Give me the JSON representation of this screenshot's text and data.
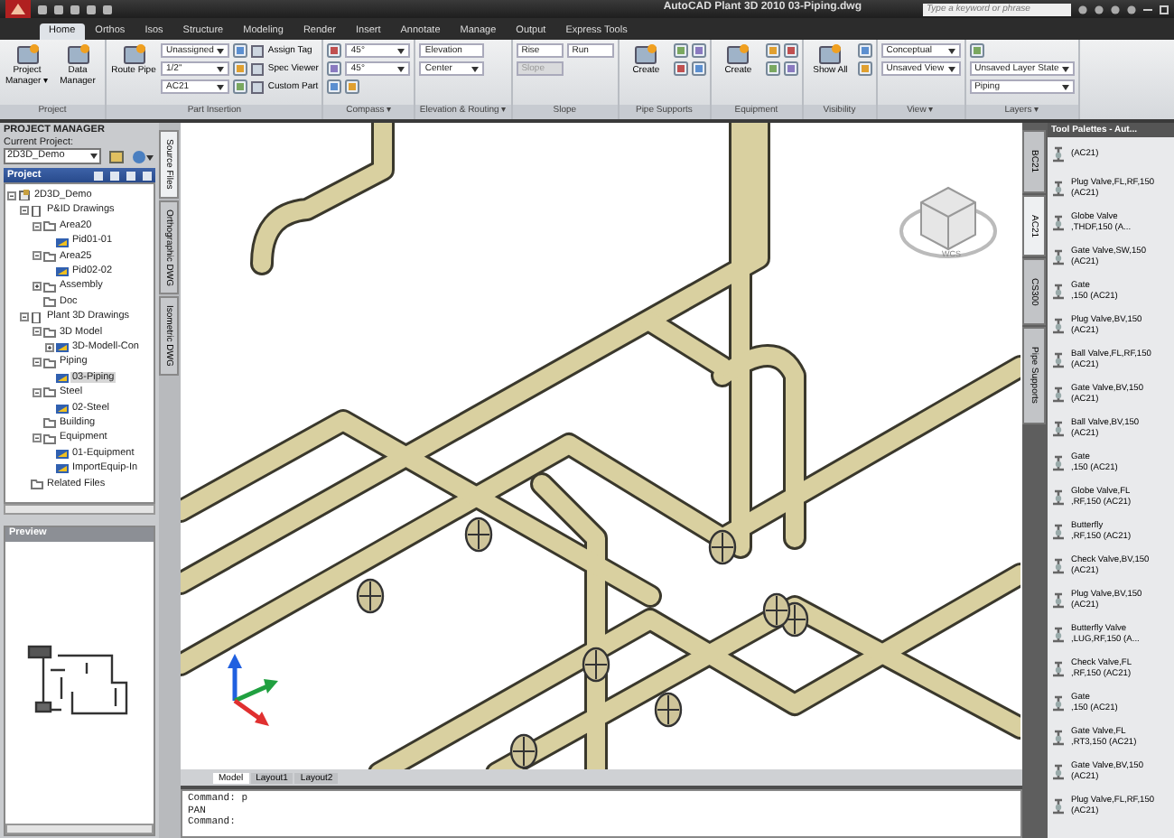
{
  "title_bar": {
    "title": "AutoCAD Plant 3D 2010",
    "file": "03-Piping.dwg",
    "search": {
      "placeholder": "Type a keyword or phrase"
    }
  },
  "ribbon_tabs": [
    {
      "label": "Home",
      "selected": true
    },
    {
      "label": "Orthos",
      "selected": false
    },
    {
      "label": "Isos",
      "selected": false
    },
    {
      "label": "Structure",
      "selected": false
    },
    {
      "label": "Modeling",
      "selected": false
    },
    {
      "label": "Render",
      "selected": false
    },
    {
      "label": "Insert",
      "selected": false
    },
    {
      "label": "Annotate",
      "selected": false
    },
    {
      "label": "Manage",
      "selected": false
    },
    {
      "label": "Output",
      "selected": false
    },
    {
      "label": "Express Tools",
      "selected": false
    }
  ],
  "ribbon_panels": [
    {
      "title": "Project",
      "columns": [
        [
          {
            "kind": "large",
            "label": "Project Manager ▾"
          }
        ],
        [
          {
            "kind": "large",
            "label": "Data Manager"
          }
        ]
      ]
    },
    {
      "title": "Part Insertion",
      "columns": [
        [
          {
            "kind": "large",
            "label": "Route Pipe"
          }
        ],
        [
          {
            "kind": "combo",
            "value": "Unassigned"
          },
          {
            "kind": "combo",
            "value": "1/2\""
          },
          {
            "kind": "combo",
            "value": "AC21"
          }
        ],
        [
          {
            "kind": "icon"
          },
          {
            "kind": "icon"
          },
          {
            "kind": "icon"
          }
        ],
        [
          {
            "kind": "small",
            "label": "Assign Tag"
          },
          {
            "kind": "small",
            "label": "Spec Viewer"
          },
          {
            "kind": "small",
            "label": "Custom Part"
          }
        ]
      ]
    },
    {
      "title": "Compass ▾",
      "columns": [
        [
          {
            "kind": "icon"
          },
          {
            "kind": "icon"
          },
          {
            "kind": "icon"
          }
        ],
        [
          {
            "kind": "combo",
            "value": "45°"
          },
          {
            "kind": "combo",
            "value": "45°"
          },
          {
            "kind": "icon"
          }
        ]
      ]
    },
    {
      "title": "Elevation & Routing ▾",
      "columns": [
        [
          {
            "kind": "field",
            "value": "Elevation",
            "disabled": false
          },
          {
            "kind": "combo",
            "value": "Center"
          }
        ]
      ]
    },
    {
      "title": "Slope",
      "columns": [
        [
          {
            "kind": "field",
            "value": "Rise",
            "disabled": false
          },
          {
            "kind": "field",
            "value": "Slope",
            "disabled": true
          }
        ],
        [
          {
            "kind": "field",
            "value": "Run",
            "disabled": false
          }
        ]
      ]
    },
    {
      "title": "Pipe Supports",
      "columns": [
        [
          {
            "kind": "large",
            "label": "Create"
          }
        ],
        [
          {
            "kind": "icon"
          },
          {
            "kind": "icon"
          }
        ],
        [
          {
            "kind": "icon"
          },
          {
            "kind": "icon"
          }
        ]
      ]
    },
    {
      "title": "Equipment",
      "columns": [
        [
          {
            "kind": "large",
            "label": "Create"
          }
        ],
        [
          {
            "kind": "icon"
          },
          {
            "kind": "icon"
          }
        ],
        [
          {
            "kind": "icon"
          },
          {
            "kind": "icon"
          }
        ]
      ]
    },
    {
      "title": "Visibility",
      "columns": [
        [
          {
            "kind": "large",
            "label": "Show All"
          }
        ],
        [
          {
            "kind": "icon"
          },
          {
            "kind": "icon"
          }
        ]
      ]
    },
    {
      "title": "View ▾",
      "columns": [
        [
          {
            "kind": "combo",
            "value": "Conceptual"
          },
          {
            "kind": "combo",
            "value": "Unsaved View"
          }
        ]
      ]
    },
    {
      "title": "Layers ▾",
      "columns": [
        [
          {
            "kind": "icon"
          },
          {
            "kind": "combo",
            "value": "Unsaved Layer State"
          },
          {
            "kind": "combo",
            "value": "Piping"
          }
        ]
      ]
    }
  ],
  "project_manager": {
    "title": "PROJECT MANAGER",
    "current_project_label": "Current Project:",
    "current_project": "2D3D_Demo",
    "tree_title": "Project",
    "tree": [
      {
        "label": "2D3D_Demo",
        "kind": "project",
        "expanded": true,
        "selected": false,
        "children": [
          {
            "label": "P&ID Drawings",
            "kind": "set",
            "expanded": true,
            "selected": false,
            "children": [
              {
                "label": "Area20",
                "kind": "folder",
                "expanded": true,
                "selected": false,
                "children": [
                  {
                    "label": "Pid01-01",
                    "kind": "drawing",
                    "selected": false
                  }
                ]
              },
              {
                "label": "Area25",
                "kind": "folder",
                "expanded": true,
                "selected": false,
                "children": [
                  {
                    "label": "Pid02-02",
                    "kind": "drawing",
                    "selected": false
                  }
                ]
              },
              {
                "label": "Assembly",
                "kind": "folder",
                "expanded": false,
                "selected": false
              },
              {
                "label": "Doc",
                "kind": "folder",
                "selected": false
              }
            ]
          },
          {
            "label": "Plant 3D Drawings",
            "kind": "set",
            "expanded": true,
            "selected": false,
            "children": [
              {
                "label": "3D Model",
                "kind": "folder",
                "expanded": true,
                "selected": false,
                "children": [
                  {
                    "label": "3D-Modell-Con",
                    "kind": "drawing",
                    "expanded": false,
                    "selected": false
                  }
                ]
              },
              {
                "label": "Piping",
                "kind": "folder",
                "expanded": true,
                "selected": false,
                "children": [
                  {
                    "label": "03-Piping",
                    "kind": "drawing",
                    "selected": true
                  }
                ]
              },
              {
                "label": "Steel",
                "kind": "folder",
                "expanded": true,
                "selected": false,
                "children": [
                  {
                    "label": "02-Steel",
                    "kind": "drawing",
                    "selected": false
                  }
                ]
              },
              {
                "label": "Building",
                "kind": "folder",
                "selected": false
              },
              {
                "label": "Equipment",
                "kind": "folder",
                "expanded": true,
                "selected": false,
                "children": [
                  {
                    "label": "01-Equipment",
                    "kind": "drawing",
                    "selected": false
                  },
                  {
                    "label": "ImportEquip-In",
                    "kind": "drawing",
                    "selected": false
                  }
                ]
              }
            ]
          },
          {
            "label": "Related Files",
            "kind": "folder",
            "selected": false
          }
        ]
      }
    ],
    "side_tabs": [
      {
        "label": "Source Files",
        "selected": true
      },
      {
        "label": "Orthographic DWG",
        "selected": false
      },
      {
        "label": "Isometric DWG",
        "selected": false
      }
    ],
    "preview_title": "Preview"
  },
  "viewport": {
    "viewcube_label": "WCS",
    "layout_tabs": [
      {
        "label": "Model",
        "selected": true
      },
      {
        "label": "Layout1",
        "selected": false
      },
      {
        "label": "Layout2",
        "selected": false
      }
    ]
  },
  "command_lines": [
    "Command: p",
    "PAN",
    "Command:"
  ],
  "tool_palette": {
    "title": "Tool Palettes - Aut...",
    "tabs": [
      {
        "label": "BC21",
        "selected": false
      },
      {
        "label": "AC21",
        "selected": true
      },
      {
        "label": "CS300",
        "selected": false
      },
      {
        "label": "Pipe Supports",
        "selected": false
      }
    ],
    "items": [
      {
        "line1": "(AC21)"
      },
      {
        "line1": "Plug Valve,FL,RF,150",
        "line2": "(AC21)"
      },
      {
        "line1": "Globe Valve",
        "line2": ",THDF,150 (A..."
      },
      {
        "line1": "Gate Valve,SW,150",
        "line2": "(AC21)"
      },
      {
        "line1": "Gate",
        "line2": ",150 (AC21)"
      },
      {
        "line1": "Plug Valve,BV,150",
        "line2": "(AC21)"
      },
      {
        "line1": "Ball Valve,FL,RF,150",
        "line2": "(AC21)"
      },
      {
        "line1": "Gate Valve,BV,150",
        "line2": "(AC21)"
      },
      {
        "line1": "Ball Valve,BV,150",
        "line2": "(AC21)"
      },
      {
        "line1": "Gate",
        "line2": ",150 (AC21)"
      },
      {
        "line1": "Globe Valve,FL",
        "line2": ",RF,150 (AC21)"
      },
      {
        "line1": "Butterfly",
        "line2": ",RF,150 (AC21)"
      },
      {
        "line1": "Check Valve,BV,150",
        "line2": "(AC21)"
      },
      {
        "line1": "Plug Valve,BV,150",
        "line2": "(AC21)"
      },
      {
        "line1": "Butterfly Valve",
        "line2": ",LUG,RF,150 (A..."
      },
      {
        "line1": "Check Valve,FL",
        "line2": ",RF,150 (AC21)"
      },
      {
        "line1": "Gate",
        "line2": ",150 (AC21)"
      },
      {
        "line1": "Gate Valve,FL",
        "line2": ",RT3,150 (AC21)"
      },
      {
        "line1": "Gate Valve,BV,150",
        "line2": "(AC21)"
      },
      {
        "line1": "Plug Valve,FL,RF,150",
        "line2": "(AC21)"
      }
    ]
  }
}
